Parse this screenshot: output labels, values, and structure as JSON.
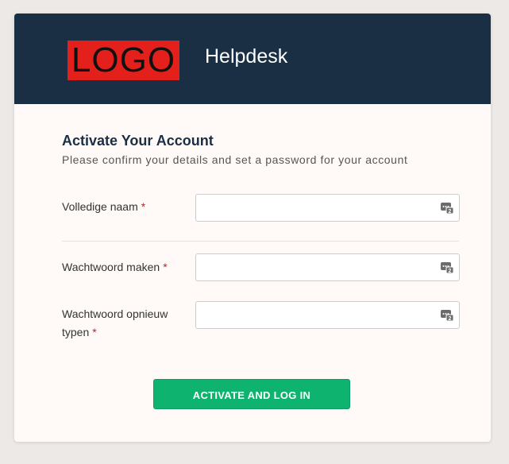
{
  "header": {
    "logo_text": "LOGO",
    "app_title": "Helpdesk"
  },
  "form": {
    "heading": "Activate Your Account",
    "subheading": "Please confirm your details and set a password for your account",
    "required_marker": "*",
    "fields": [
      {
        "label": "Volledige naam",
        "value": "",
        "placeholder": "",
        "icon": "password-manager-key-icon"
      },
      {
        "label": "Wachtwoord maken",
        "value": "",
        "placeholder": "",
        "icon": "password-manager-key-icon"
      },
      {
        "label": "Wachtwoord opnieuw typen",
        "value": "",
        "placeholder": "",
        "icon": "password-manager-key-icon"
      }
    ],
    "submit_label": "ACTIVATE AND LOG IN"
  },
  "colors": {
    "header_bg": "#1a2e44",
    "logo_bg": "#e3201b",
    "button_bg": "#0fb370",
    "required": "#c8202a"
  }
}
